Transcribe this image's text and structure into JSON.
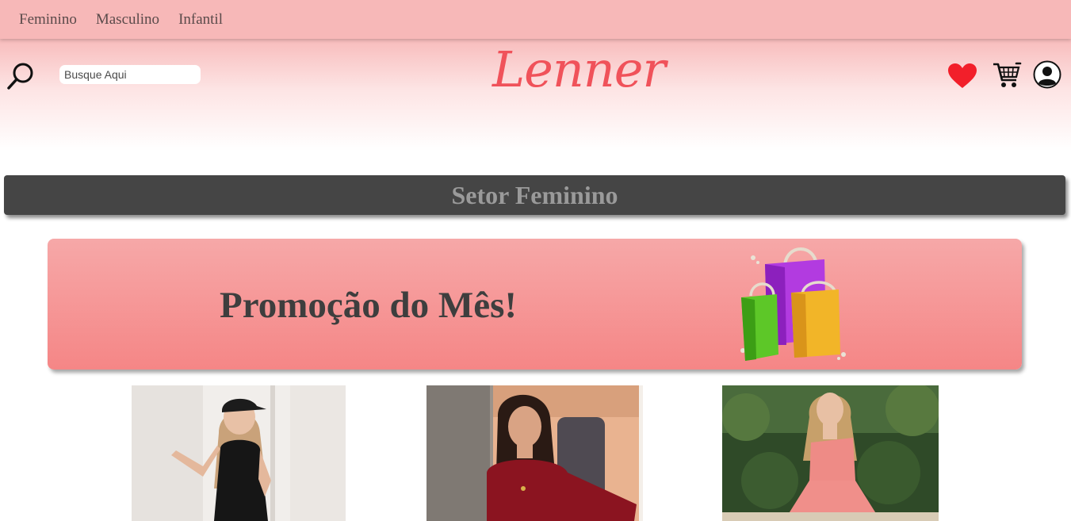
{
  "nav": {
    "items": [
      {
        "label": "Feminino"
      },
      {
        "label": "Masculino"
      },
      {
        "label": "Infantil"
      }
    ]
  },
  "header": {
    "search_placeholder": "Busque Aqui",
    "logo_text": "Lenner"
  },
  "section": {
    "title": "Setor Feminino"
  },
  "promo": {
    "title": "Promoção do Mês!"
  },
  "colors": {
    "nav_bg": "#f7b8b8",
    "accent": "#f0525a",
    "section_bar": "#454545",
    "promo_top": "#f6a8a8",
    "promo_bottom": "#f58686"
  },
  "icons": [
    "search-icon",
    "heart-icon",
    "cart-icon",
    "user-icon",
    "shopping-bags-icon"
  ]
}
